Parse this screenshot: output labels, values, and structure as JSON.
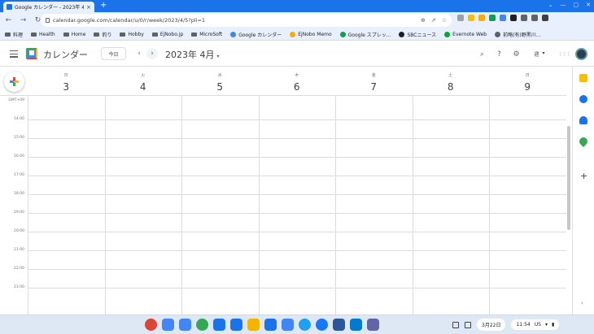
{
  "browser": {
    "tab_title": "Google カレンダー - 2023年 4",
    "tab_close": "×",
    "new_tab": "+",
    "url": "calendar.google.com/calendar/u/0/r/week/2023/4/5?pli=1",
    "window_controls": [
      "⌄",
      "—",
      "▢",
      "✕"
    ],
    "nav": {
      "back": "←",
      "forward": "→",
      "reload": "↻"
    },
    "omni_actions": [
      "⊕",
      "⇗",
      "☆"
    ],
    "extension_colors": [
      "#9aa0a6",
      "#fbbc04",
      "#f9ab00",
      "#0f9d58",
      "#4285f4",
      "#1f1f1f",
      "#5f6368",
      "#5f6368",
      "#3c4043"
    ]
  },
  "bookmarks": [
    {
      "label": "料理",
      "icon": "folder"
    },
    {
      "label": "Health",
      "icon": "folder"
    },
    {
      "label": "Home",
      "icon": "folder"
    },
    {
      "label": "釣り",
      "icon": "folder"
    },
    {
      "label": "Hobby",
      "icon": "folder"
    },
    {
      "label": "EjNobo.jp",
      "icon": "folder"
    },
    {
      "label": "MicroSoft",
      "icon": "folder"
    },
    {
      "label": "Google カレンダー",
      "icon": "calendar",
      "color": "#4285f4"
    },
    {
      "label": "EjNobo Memo",
      "icon": "memo",
      "color": "#f9ab00"
    },
    {
      "label": "Google スプレッ...",
      "icon": "sheets",
      "color": "#0f9d58"
    },
    {
      "label": "SBCニュース",
      "icon": "news",
      "color": "#1f1f1f"
    },
    {
      "label": "Evernote Web",
      "icon": "evernote",
      "color": "#00a82d"
    },
    {
      "label": "前略(有)野黒川...",
      "icon": "globe",
      "color": "#5f6368"
    }
  ],
  "calendar": {
    "app_title": "カレンダー",
    "today_button": "今日",
    "prev": "‹",
    "next": "›",
    "month_label": "2023年 4月",
    "month_dropdown": "▾",
    "view_label": "週",
    "view_dropdown": "▾",
    "header_icons": {
      "search": "⌕",
      "help": "?",
      "settings": "⚙",
      "apps": "⋮⋮⋮"
    },
    "days": [
      {
        "dow": "日",
        "date": "3"
      },
      {
        "dow": "火",
        "date": "4"
      },
      {
        "dow": "水",
        "date": "5"
      },
      {
        "dow": "木",
        "date": "6"
      },
      {
        "dow": "金",
        "date": "7"
      },
      {
        "dow": "土",
        "date": "8"
      },
      {
        "dow": "日",
        "date": "9"
      }
    ],
    "hours": [
      "GMT+09",
      "14:00",
      "15:00",
      "16:00",
      "17:00",
      "18:00",
      "19:00",
      "20:00",
      "21:00",
      "22:00",
      "23:00"
    ]
  },
  "side_panel": {
    "icon_colors": [
      "#fbbc04",
      "#1a73e8",
      "#1a73e8",
      "#34a853"
    ],
    "add": "+",
    "expand": "›"
  },
  "shelf": {
    "app_colors": [
      "#db4437",
      "#4285f4",
      "#4285f4",
      "#34a853",
      "#1a73e8",
      "#1a73e8",
      "#f4b400",
      "#1a73e8",
      "#4285f4",
      "#1da1f2",
      "#1877f2",
      "#2b579a",
      "#007acc",
      "#6264a7"
    ],
    "date": "3月22日",
    "time": "11:54",
    "ime": "US",
    "tray_icons": [
      "▾",
      "◔",
      "▮"
    ]
  }
}
